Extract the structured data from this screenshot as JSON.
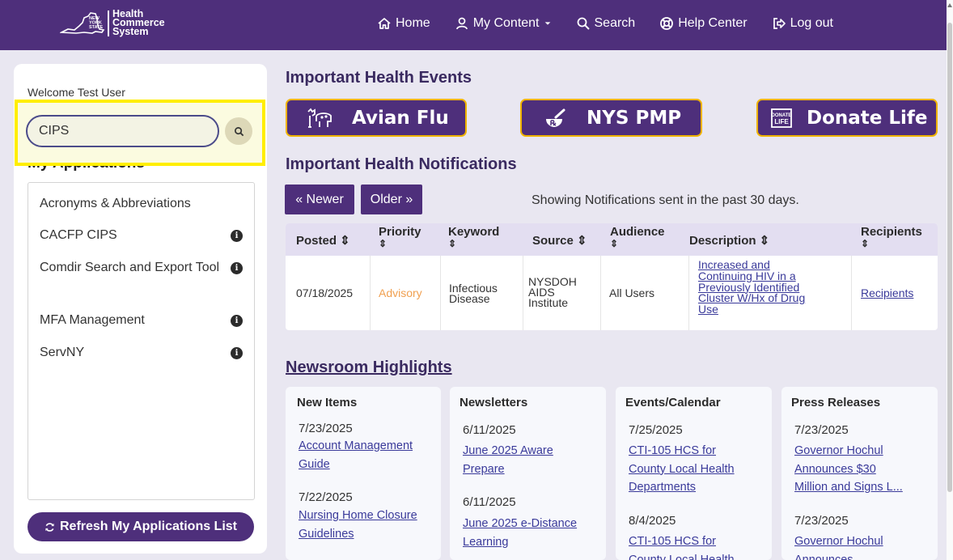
{
  "logo": {
    "state_text": [
      "NEW",
      "YORK",
      "STATE"
    ],
    "lines": [
      "Health",
      "Commerce",
      "System"
    ]
  },
  "nav": {
    "home": "Home",
    "my_content": "My Content",
    "search": "Search",
    "help_center": "Help Center",
    "log_out": "Log out"
  },
  "sidebar": {
    "welcome": "Welcome Test User",
    "search_value": "CIPS",
    "apps_title": "My Applications",
    "apps": [
      {
        "label": "Acronyms & Abbreviations",
        "info": false
      },
      {
        "label": "CACFP CIPS",
        "info": true
      },
      {
        "label": "Comdir Search and Export Tool",
        "info": true
      },
      {
        "label": "MFA Management",
        "info": true
      },
      {
        "label": "ServNY",
        "info": true
      }
    ],
    "info_glyph": "i",
    "refresh_label": "Refresh My Applications List"
  },
  "events": {
    "title": "Important Health Events",
    "buttons": [
      {
        "label": "Avian Flu",
        "icon": "bird-flu-icon"
      },
      {
        "label": "NYS PMP",
        "icon": "prescription-icon"
      },
      {
        "label": "Donate Life",
        "icon": "donate-life-icon",
        "icon_text": [
          "DONATE",
          "LIFE"
        ]
      }
    ]
  },
  "notifications": {
    "title": "Important Health Notifications",
    "newer": "« Newer",
    "older": "Older »",
    "showing": "Showing Notifications sent in the past 30 days.",
    "headers": {
      "posted": "Posted ⇕",
      "priority": "Priority",
      "keyword": "Keyword",
      "source": "Source ⇕",
      "audience": "Audience",
      "description": "Description ⇕",
      "recipients": "Recipients"
    },
    "sort_glyph": "⇕",
    "row": {
      "posted": "07/18/2025",
      "priority": "Advisory",
      "keyword": [
        "Infectious",
        "Disease"
      ],
      "source": [
        "NYSDOH",
        "AIDS",
        "Institute"
      ],
      "audience": "All Users",
      "description": [
        "Increased and",
        "Continuing HIV in a",
        "Previously Identified",
        "Cluster W/Hx of Drug",
        "Use"
      ],
      "recipients": "Recipients"
    },
    "priority_color": "#f0a050"
  },
  "newsroom": {
    "title": "Newsroom Highlights",
    "columns": [
      {
        "header": "New Items",
        "entries": [
          {
            "date": "7/23/2025",
            "link": [
              "Account Management",
              "Guide"
            ]
          },
          {
            "date": "7/22/2025",
            "link": [
              "Nursing Home Closure",
              "Guidelines"
            ]
          }
        ]
      },
      {
        "header": "Newsletters",
        "entries": [
          {
            "date": "6/11/2025",
            "link": [
              "June 2025 Aware",
              "Prepare"
            ]
          },
          {
            "date": "6/11/2025",
            "link": [
              "June 2025 e-Distance",
              "Learning"
            ]
          }
        ]
      },
      {
        "header": "Events/Calendar",
        "entries": [
          {
            "date": "7/25/2025",
            "link": [
              "CTI-105 HCS for",
              "County Local Health",
              "Departments"
            ]
          },
          {
            "date": "8/4/2025",
            "link": [
              "CTI-105 HCS for",
              "County Local Health"
            ]
          }
        ]
      },
      {
        "header": "Press Releases",
        "entries": [
          {
            "date": "7/23/2025",
            "link": [
              "Governor Hochul",
              "Announces $30",
              "Million and Signs L..."
            ]
          },
          {
            "date": "7/23/2025",
            "link": [
              "Governor Hochul",
              "Announces"
            ]
          }
        ]
      }
    ]
  },
  "colors": {
    "brand": "#4e2f7b",
    "gold": "#f0b400",
    "highlight": "#ffee00"
  }
}
